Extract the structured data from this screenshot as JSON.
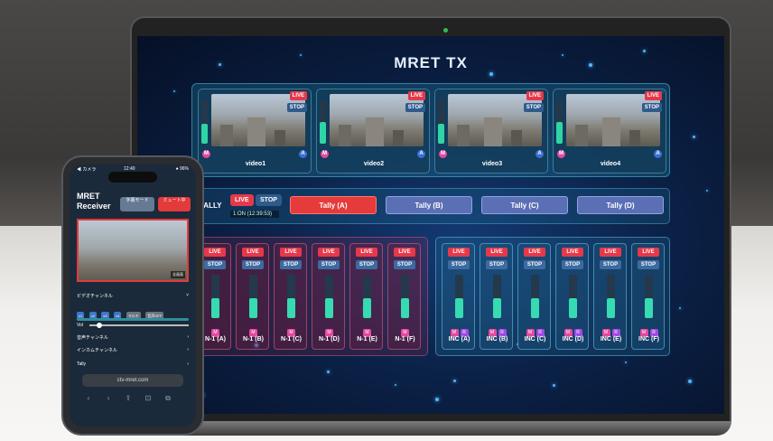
{
  "laptop": {
    "app_title": "MRET TX",
    "videos": [
      {
        "label": "video1",
        "live": "LIVE",
        "stop": "STOP",
        "m": "M",
        "a": "A",
        "level": 0.45
      },
      {
        "label": "video2",
        "live": "LIVE",
        "stop": "STOP",
        "m": "M",
        "a": "A",
        "level": 0.5
      },
      {
        "label": "video3",
        "live": "LIVE",
        "stop": "STOP",
        "m": "M",
        "a": "A",
        "level": 0.45
      },
      {
        "label": "video4",
        "live": "LIVE",
        "stop": "STOP",
        "m": "M",
        "a": "A",
        "level": 0.5
      }
    ],
    "tally": {
      "label": "TALLY",
      "live": "LIVE",
      "stop": "STOP",
      "on_air": "1:ON (12:39:53)",
      "buttons": [
        "Tally (A)",
        "Tally (B)",
        "Tally (C)",
        "Tally (D)"
      ],
      "active_index": 0
    },
    "n_channels": [
      {
        "label": "N-1 (A)",
        "level": 0.45
      },
      {
        "label": "N-1 (B)",
        "level": 0.45
      },
      {
        "label": "N-1 (C)",
        "level": 0.45
      },
      {
        "label": "N-1 (D)",
        "level": 0.45
      },
      {
        "label": "N-1 (E)",
        "level": 0.45
      },
      {
        "label": "N-1 (F)",
        "level": 0.45
      }
    ],
    "inc_channels": [
      {
        "label": "INC (A)",
        "level": 0.45
      },
      {
        "label": "INC (B)",
        "level": 0.45
      },
      {
        "label": "INC (C)",
        "level": 0.45
      },
      {
        "label": "INC (D)",
        "level": 0.45
      },
      {
        "label": "INC (E)",
        "level": 0.45
      },
      {
        "label": "INC (F)",
        "level": 0.45
      }
    ],
    "ch_live": "LIVE",
    "ch_stop": "STOP",
    "ch_m": "M",
    "ch_r": "R"
  },
  "phone": {
    "status_left": "◀ カメラ",
    "status_time": "12:40",
    "status_right": "● 96%",
    "title": "MRET Receiver",
    "btn_mode": "字幕モード",
    "btn_mute": "ミュート中",
    "video_caption": "全画面",
    "video_channel": "ビデオチャンネル",
    "chips": [
      "v1",
      "v2",
      "v3",
      "v4",
      "マルチ",
      "音声OFF"
    ],
    "vol_label": "Vol",
    "audio_channel": "音声チャンネル",
    "intercom_channel": "インカムチャンネル",
    "tally": "Tally",
    "url": "ctv-mret.com",
    "nav": [
      "‹",
      "›",
      "⇪",
      "⊡",
      "⧉"
    ]
  },
  "colors": {
    "live": "#e5394b",
    "stop": "#2f5b8c",
    "meter": "#36dbb2",
    "tally_active": "#e53b3b",
    "tally_idle": "#5b6fb4"
  }
}
